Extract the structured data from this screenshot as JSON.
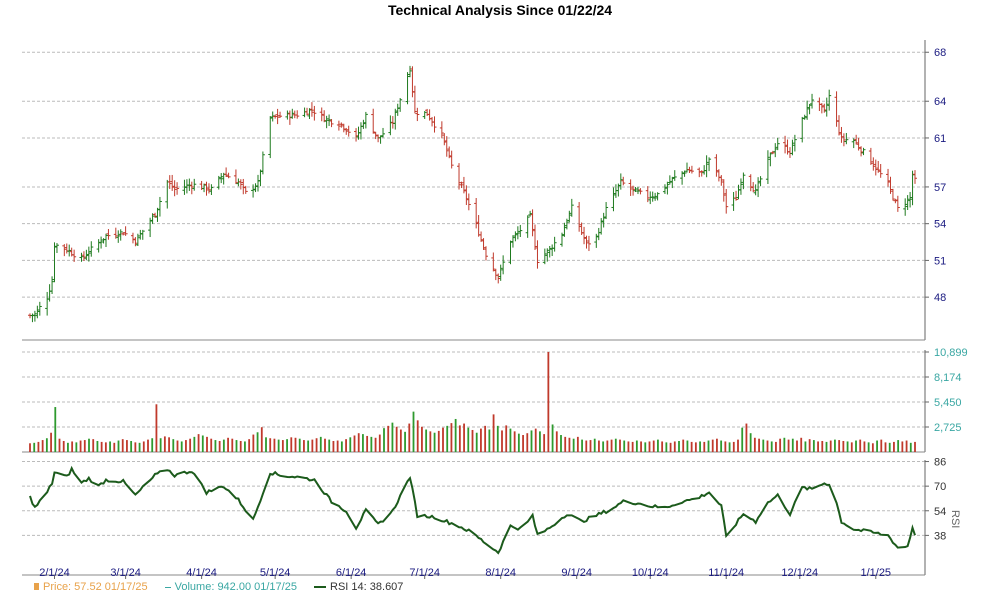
{
  "title": "Technical Analysis Since 01/22/24",
  "legend": {
    "price": "Price: 57.52  01/17/25",
    "volume": "Volume: 942.00  01/17/25",
    "rsi": "RSI 14: 38.607"
  },
  "colors": {
    "up": "#1e7a1e",
    "down": "#c0392b",
    "rsi": "#1c5b1c",
    "axis_text": "#1a1a80",
    "grid": "#bbbbbb"
  },
  "chart_data": [
    {
      "type": "ohlc",
      "title": "Technical Analysis Since 01/22/24",
      "x_tick_labels": [
        "2/1/24",
        "3/1/24",
        "4/1/24",
        "5/1/24",
        "6/1/24",
        "7/1/24",
        "8/1/24",
        "9/1/24",
        "10/1/24",
        "11/1/24",
        "12/1/24",
        "1/1/25"
      ],
      "y_tick_labels": [
        "68",
        "64",
        "61",
        "57",
        "54",
        "51",
        "48"
      ],
      "ylim": [
        44.5,
        69
      ],
      "grid": true,
      "close_anchors": [
        [
          "2024-01-22",
          46.5
        ],
        [
          "2024-01-24",
          46.6
        ],
        [
          "2024-01-29",
          48.0
        ],
        [
          "2024-01-31",
          49.3
        ],
        [
          "2024-02-01",
          52.3
        ],
        [
          "2024-02-06",
          51.9
        ],
        [
          "2024-02-12",
          51.1
        ],
        [
          "2024-02-16",
          51.9
        ],
        [
          "2024-02-22",
          53.0
        ],
        [
          "2024-02-29",
          53.3
        ],
        [
          "2024-03-05",
          52.6
        ],
        [
          "2024-03-08",
          53.4
        ],
        [
          "2024-03-13",
          54.8
        ],
        [
          "2024-03-18",
          57.4
        ],
        [
          "2024-03-21",
          56.8
        ],
        [
          "2024-03-28",
          57.2
        ],
        [
          "2024-04-05",
          56.8
        ],
        [
          "2024-04-10",
          58.1
        ],
        [
          "2024-04-16",
          57.4
        ],
        [
          "2024-04-19",
          56.5
        ],
        [
          "2024-04-24",
          57.3
        ],
        [
          "2024-04-29",
          62.6
        ],
        [
          "2024-05-03",
          62.8
        ],
        [
          "2024-05-10",
          62.9
        ],
        [
          "2024-05-16",
          63.3
        ],
        [
          "2024-05-22",
          62.5
        ],
        [
          "2024-05-28",
          62.1
        ],
        [
          "2024-06-03",
          61.0
        ],
        [
          "2024-06-07",
          62.8
        ],
        [
          "2024-06-12",
          60.9
        ],
        [
          "2024-06-18",
          62.3
        ],
        [
          "2024-06-25",
          66.7
        ],
        [
          "2024-06-27",
          63.1
        ],
        [
          "2024-07-02",
          63.0
        ],
        [
          "2024-07-08",
          61.2
        ],
        [
          "2024-07-12",
          58.7
        ],
        [
          "2024-07-18",
          56.1
        ],
        [
          "2024-07-23",
          53.3
        ],
        [
          "2024-07-26",
          51.5
        ],
        [
          "2024-07-31",
          49.6
        ],
        [
          "2024-08-05",
          52.6
        ],
        [
          "2024-08-08",
          53.2
        ],
        [
          "2024-08-13",
          54.6
        ],
        [
          "2024-08-16",
          51.0
        ],
        [
          "2024-08-21",
          51.9
        ],
        [
          "2024-08-26",
          53.2
        ],
        [
          "2024-08-30",
          55.3
        ],
        [
          "2024-09-05",
          52.3
        ],
        [
          "2024-09-09",
          52.9
        ],
        [
          "2024-09-13",
          55.2
        ],
        [
          "2024-09-19",
          57.4
        ],
        [
          "2024-09-24",
          56.7
        ],
        [
          "2024-09-30",
          56.2
        ],
        [
          "2024-10-04",
          56.4
        ],
        [
          "2024-10-10",
          57.6
        ],
        [
          "2024-10-16",
          58.4
        ],
        [
          "2024-10-22",
          58.1
        ],
        [
          "2024-10-25",
          59.3
        ],
        [
          "2024-10-30",
          57.4
        ],
        [
          "2024-11-01",
          55.4
        ],
        [
          "2024-11-05",
          56.1
        ],
        [
          "2024-11-08",
          58.1
        ],
        [
          "2024-11-13",
          56.6
        ],
        [
          "2024-11-18",
          59.2
        ],
        [
          "2024-11-22",
          60.6
        ],
        [
          "2024-11-27",
          59.9
        ],
        [
          "2024-12-03",
          62.9
        ],
        [
          "2024-12-06",
          64.2
        ],
        [
          "2024-12-11",
          63.1
        ],
        [
          "2024-12-13",
          64.4
        ],
        [
          "2024-12-18",
          60.9
        ],
        [
          "2024-12-23",
          60.8
        ],
        [
          "2024-12-30",
          59.1
        ],
        [
          "2025-01-06",
          57.2
        ],
        [
          "2025-01-10",
          55.2
        ],
        [
          "2025-01-15",
          56.1
        ],
        [
          "2025-01-16",
          58.0
        ],
        [
          "2025-01-17",
          57.5
        ]
      ]
    },
    {
      "type": "bar",
      "title": "Volume",
      "y_tick_labels": [
        "10,899",
        "8,174",
        "5,450",
        "2,725"
      ],
      "ylim": [
        0,
        10899
      ],
      "series": [
        {
          "name": "Volume",
          "values": [
            950,
            1000,
            1100,
            1300,
            1500,
            2100,
            4900,
            1450,
            1200,
            1000,
            1150,
            1050,
            1250,
            1300,
            1450,
            1400,
            1200,
            1100,
            1050,
            1150,
            1000,
            1250,
            1400,
            1300,
            1200,
            1050,
            1000,
            1150,
            1350,
            1500,
            5200,
            1500,
            1700,
            1600,
            1400,
            1250,
            1150,
            1300,
            1450,
            1650,
            1950,
            1800,
            1650,
            1450,
            1300,
            1200,
            1350,
            1550,
            1450,
            1300,
            1200,
            1150,
            1400,
            1900,
            2150,
            2700,
            1600,
            1500,
            1450,
            1350,
            1300,
            1400,
            1600,
            1550,
            1450,
            1300,
            1250,
            1350,
            1500,
            1650,
            1450,
            1350,
            1200,
            1250,
            1150,
            1400,
            1600,
            1800,
            2050,
            1950,
            1750,
            1650,
            1550,
            1900,
            2600,
            2850,
            3200,
            2750,
            2450,
            2200,
            3100,
            4400,
            3450,
            2750,
            2450,
            2250,
            2100,
            2300,
            2650,
            2850,
            3150,
            3600,
            2900,
            3100,
            2650,
            2400,
            2100,
            2550,
            2850,
            2450,
            4100,
            2850,
            2350,
            2900,
            2550,
            2250,
            2000,
            1850,
            2050,
            2350,
            2550,
            2250,
            1950,
            10899,
            3000,
            2250,
            1850,
            1650,
            1550,
            1450,
            1650,
            1350,
            1250,
            1300,
            1450,
            1250,
            1150,
            1250,
            1350,
            1450,
            1350,
            1250,
            1150,
            1100,
            1250,
            1150,
            1050,
            1150,
            1250,
            1350,
            1150,
            1050,
            1000,
            1150,
            1200,
            1350,
            1250,
            1100,
            1050,
            1150,
            1100,
            1250,
            1350,
            1450,
            1250,
            1150,
            1050,
            1100,
            1350,
            2650,
            3100,
            2050,
            1550,
            1450,
            1350,
            1250,
            1150,
            1100,
            1450,
            1550,
            1350,
            1450,
            1250,
            1550,
            1150,
            1400,
            1300,
            1150,
            1200,
            1100,
            1250,
            1350,
            1300,
            1200,
            1150,
            1050,
            1250,
            1350,
            1150,
            1050,
            950,
            1250,
            1350,
            1050,
            1000,
            1100,
            1300,
            1150,
            1250,
            1000,
            1100
          ]
        }
      ]
    },
    {
      "type": "line",
      "title": "RSI 14",
      "y_tick_labels": [
        "86",
        "70",
        "54",
        "38"
      ],
      "ylim": [
        22,
        87
      ],
      "series": [
        {
          "name": "RSI 14",
          "points": [
            [
              "2024-01-22",
              63
            ],
            [
              "2024-01-24",
              56
            ],
            [
              "2024-01-29",
              66
            ],
            [
              "2024-01-31",
              72
            ],
            [
              "2024-02-01",
              79
            ],
            [
              "2024-02-06",
              76
            ],
            [
              "2024-02-08",
              81
            ],
            [
              "2024-02-12",
              72
            ],
            [
              "2024-02-15",
              75
            ],
            [
              "2024-02-19",
              70
            ],
            [
              "2024-02-22",
              74
            ],
            [
              "2024-02-29",
              73
            ],
            [
              "2024-03-05",
              64
            ],
            [
              "2024-03-08",
              69
            ],
            [
              "2024-03-13",
              77
            ],
            [
              "2024-03-18",
              81
            ],
            [
              "2024-03-21",
              77
            ],
            [
              "2024-03-28",
              80
            ],
            [
              "2024-04-03",
              66
            ],
            [
              "2024-04-10",
              70
            ],
            [
              "2024-04-16",
              61
            ],
            [
              "2024-04-22",
              48
            ],
            [
              "2024-04-29",
              79
            ],
            [
              "2024-05-03",
              77
            ],
            [
              "2024-05-10",
              76
            ],
            [
              "2024-05-17",
              74
            ],
            [
              "2024-05-24",
              60
            ],
            [
              "2024-05-30",
              54
            ],
            [
              "2024-06-03",
              43
            ],
            [
              "2024-06-07",
              54
            ],
            [
              "2024-06-12",
              45
            ],
            [
              "2024-06-18",
              54
            ],
            [
              "2024-06-25",
              76
            ],
            [
              "2024-06-28",
              51
            ],
            [
              "2024-07-05",
              50
            ],
            [
              "2024-07-10",
              47
            ],
            [
              "2024-07-15",
              44
            ],
            [
              "2024-07-20",
              40
            ],
            [
              "2024-07-25",
              34
            ],
            [
              "2024-07-31",
              27
            ],
            [
              "2024-08-05",
              44
            ],
            [
              "2024-08-10",
              42
            ],
            [
              "2024-08-14",
              51
            ],
            [
              "2024-08-16",
              38
            ],
            [
              "2024-08-21",
              43
            ],
            [
              "2024-08-28",
              52
            ],
            [
              "2024-09-03",
              47
            ],
            [
              "2024-09-09",
              51
            ],
            [
              "2024-09-15",
              55
            ],
            [
              "2024-09-20",
              60
            ],
            [
              "2024-09-26",
              59
            ],
            [
              "2024-10-01",
              57
            ],
            [
              "2024-10-07",
              56
            ],
            [
              "2024-10-14",
              60
            ],
            [
              "2024-10-20",
              62
            ],
            [
              "2024-10-25",
              66
            ],
            [
              "2024-10-30",
              57
            ],
            [
              "2024-11-01",
              37
            ],
            [
              "2024-11-08",
              52
            ],
            [
              "2024-11-13",
              47
            ],
            [
              "2024-11-17",
              58
            ],
            [
              "2024-11-22",
              64
            ],
            [
              "2024-11-27",
              52
            ],
            [
              "2024-12-02",
              69
            ],
            [
              "2024-12-06",
              68
            ],
            [
              "2024-12-11",
              72
            ],
            [
              "2024-12-14",
              71
            ],
            [
              "2024-12-18",
              47
            ],
            [
              "2024-12-23",
              42
            ],
            [
              "2024-12-30",
              40
            ],
            [
              "2025-01-06",
              38
            ],
            [
              "2025-01-10",
              30
            ],
            [
              "2025-01-14",
              31
            ],
            [
              "2025-01-16",
              43
            ],
            [
              "2025-01-17",
              38.6
            ]
          ]
        }
      ]
    }
  ]
}
